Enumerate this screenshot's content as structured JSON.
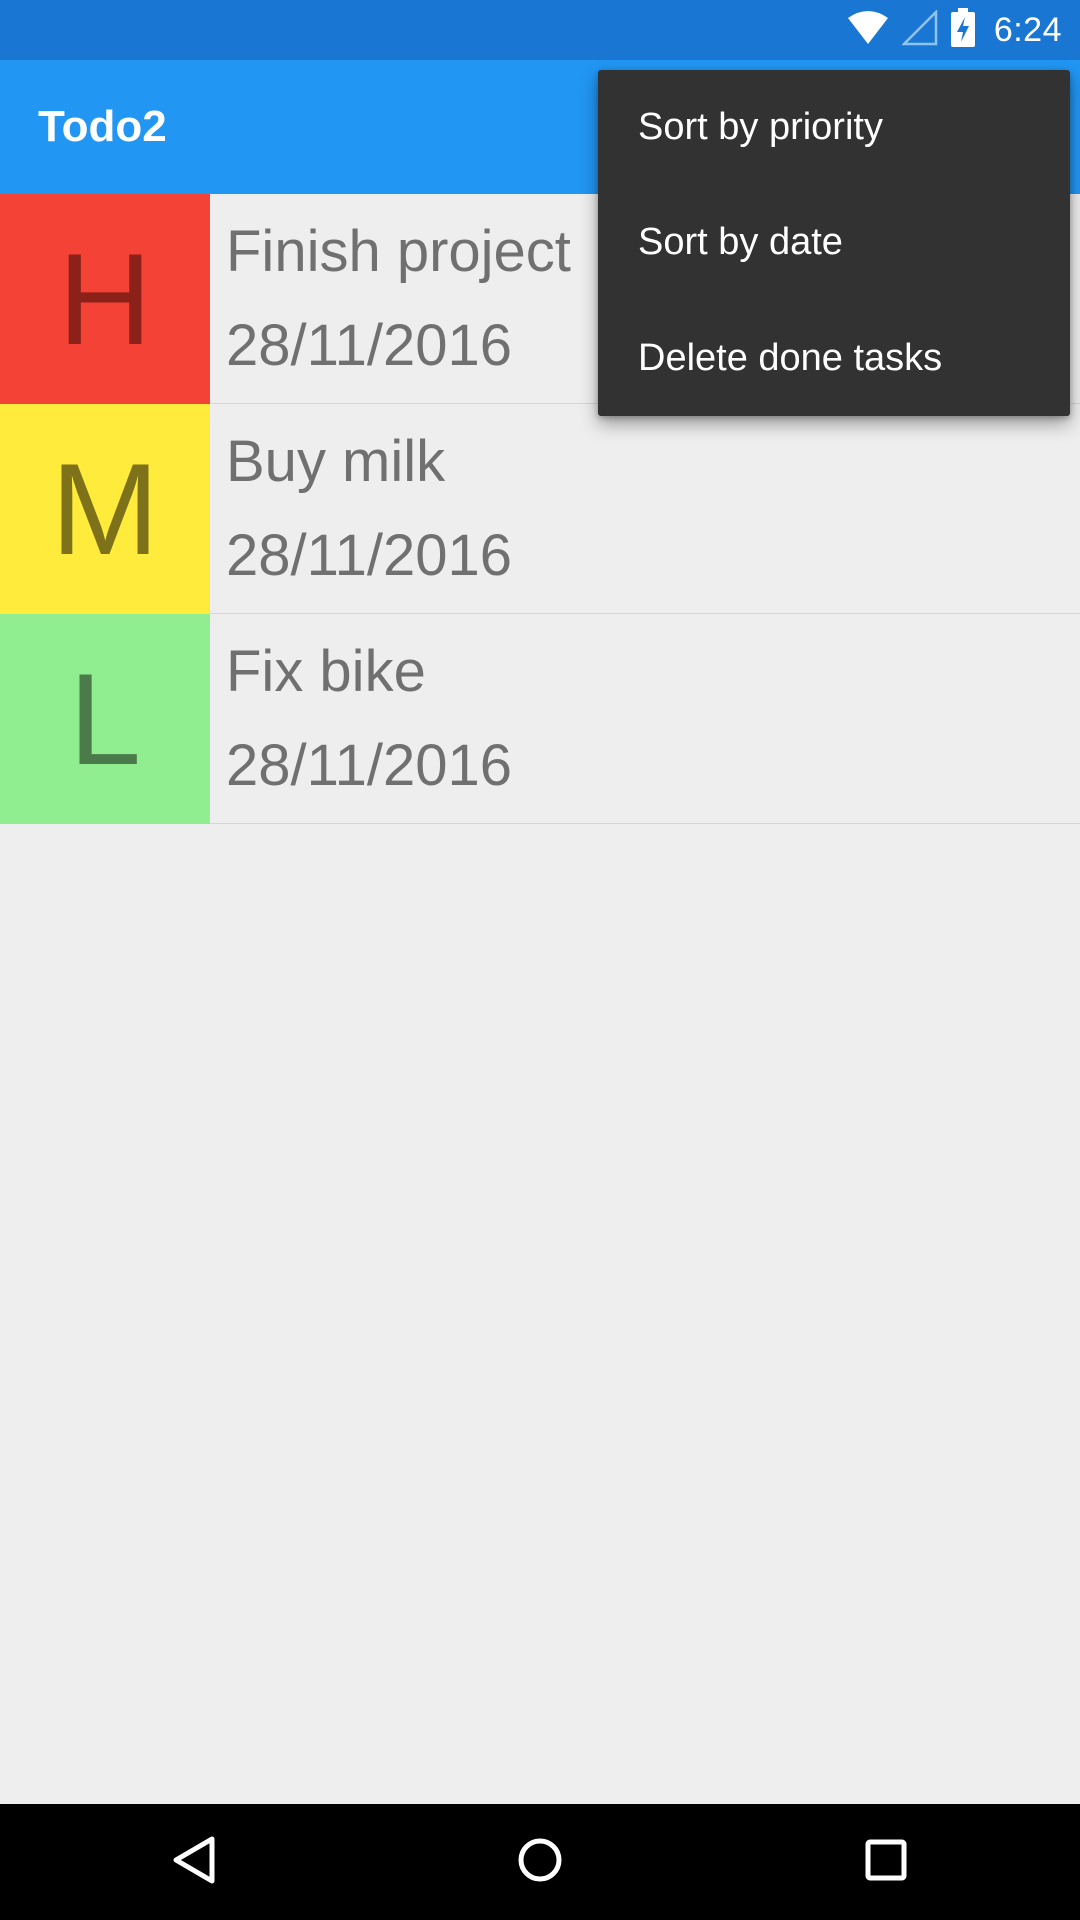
{
  "status_bar": {
    "time": "6:24",
    "background": "#1976d2",
    "icons": [
      "wifi-icon",
      "cell-signal-icon",
      "battery-charging-icon"
    ]
  },
  "app_bar": {
    "title": "Todo2",
    "background": "#2196f3"
  },
  "tasks": [
    {
      "priority": "H",
      "title": "Finish project",
      "date": "28/11/2016",
      "priority_color": "#f44336",
      "letter_color": "#8b2118"
    },
    {
      "priority": "M",
      "title": "Buy milk",
      "date": "28/11/2016",
      "priority_color": "#ffeb3b",
      "letter_color": "#7d7219"
    },
    {
      "priority": "L",
      "title": "Fix bike",
      "date": "28/11/2016",
      "priority_color": "#90ee90",
      "letter_color": "#4b7a4b"
    }
  ],
  "overflow_menu": {
    "items": [
      {
        "label": "Sort by priority"
      },
      {
        "label": "Sort by date"
      },
      {
        "label": "Delete done tasks"
      }
    ]
  },
  "nav_bar": {
    "buttons": [
      "back-icon",
      "home-icon",
      "recents-icon"
    ]
  }
}
